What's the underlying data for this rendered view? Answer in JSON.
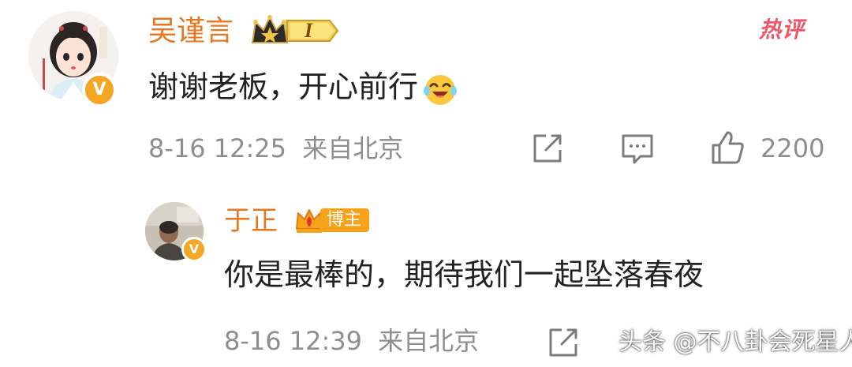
{
  "main_comment": {
    "username": "吴谨言",
    "fan_level": "I",
    "hot_label": "热评",
    "text": "谢谢老板，开心前行",
    "emoji": "laughing-emoji",
    "timestamp": "8-16 12:25",
    "location": "来自北京",
    "like_count": "2200",
    "verified_mark": "V"
  },
  "reply": {
    "username": "于正",
    "badge_label": "博主",
    "text": "你是最棒的，期待我们一起坠落春夜",
    "timestamp": "8-16 12:39",
    "location": "来自北京",
    "verified_mark": "V"
  },
  "watermark": "头条 @不八卦会死星人",
  "colors": {
    "username": "#e87720",
    "meta_gray": "#8e8e8e",
    "hot_label": "#f0566a",
    "verified": "#f5a623",
    "badge_orange": "#f7a21b"
  }
}
